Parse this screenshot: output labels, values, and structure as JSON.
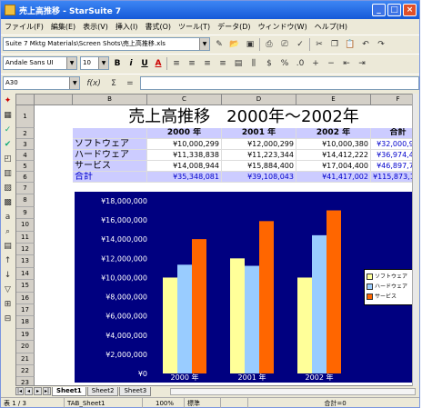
{
  "window": {
    "title": "売上高推移 - StarSuite 7",
    "buttons": [
      "_",
      "□",
      "×"
    ]
  },
  "menu": [
    "ファイル(F)",
    "編集(E)",
    "表示(V)",
    "挿入(I)",
    "書式(O)",
    "ツール(T)",
    "データ(D)",
    "ウィンドウ(W)",
    "ヘルプ(H)"
  ],
  "toolbar": {
    "path": "Suite 7 Mktg Materials\\Screen Shots\\売上高推移.xls"
  },
  "format": {
    "font": "Andale Sans UI",
    "size": "10",
    "bold": "B",
    "italic": "i",
    "underline": "U",
    "color_a": "A"
  },
  "formula": {
    "namebox": "A30",
    "fx": "f(x)",
    "sum": "Σ",
    "eq": "="
  },
  "columns": [
    "B",
    "C",
    "D",
    "E",
    "F"
  ],
  "rows": [
    "1",
    "2",
    "3",
    "4",
    "5",
    "6",
    "7",
    "8",
    "9",
    "10",
    "11",
    "12",
    "13",
    "14",
    "15",
    "16",
    "17",
    "18",
    "19",
    "20",
    "21",
    "22",
    "23",
    "24"
  ],
  "sheet": {
    "title": "売上高推移　2000年～2002年",
    "headers": [
      "2000 年",
      "2001 年",
      "2002 年",
      "合計"
    ],
    "table": [
      {
        "label": "ソフトウェア",
        "values": [
          "¥10,000,299",
          "¥12,000,299",
          "¥10,000,380",
          "¥32,000,978"
        ]
      },
      {
        "label": "ハードウェア",
        "values": [
          "¥11,338,838",
          "¥11,223,344",
          "¥14,412,222",
          "¥36,974,404"
        ]
      },
      {
        "label": "サービス",
        "values": [
          "¥14,008,944",
          "¥15,884,400",
          "¥17,004,400",
          "¥46,897,744"
        ]
      },
      {
        "label": "合計",
        "values": [
          "¥35,348,081",
          "¥39,108,043",
          "¥41,417,002",
          "¥115,873,126"
        ]
      }
    ]
  },
  "chart_data": {
    "type": "bar",
    "categories": [
      "2000 年",
      "2001 年",
      "2002 年"
    ],
    "series": [
      {
        "name": "ソフトウェア",
        "values": [
          10000299,
          12000299,
          10000380
        ],
        "color": "#ffff99"
      },
      {
        "name": "ハードウェア",
        "values": [
          11338838,
          11223344,
          14412222
        ],
        "color": "#99ccff"
      },
      {
        "name": "サービス",
        "values": [
          14008944,
          15884400,
          17004400
        ],
        "color": "#ff6600"
      }
    ],
    "ylim": [
      0,
      18000000
    ],
    "yticks": [
      "¥0",
      "¥2,000,000",
      "¥4,000,000",
      "¥6,000,000",
      "¥8,000,000",
      "¥10,000,000",
      "¥12,000,000",
      "¥14,000,000",
      "¥16,000,000",
      "¥18,000,000"
    ],
    "legend": "right",
    "background": "#000080"
  },
  "tabs": [
    "Sheet1",
    "Sheet2",
    "Sheet3"
  ],
  "status": {
    "page": "表 1 / 3",
    "style": "TAB_Sheet1",
    "zoom": "100%",
    "mode": "標準",
    "sum": "合計=0"
  }
}
